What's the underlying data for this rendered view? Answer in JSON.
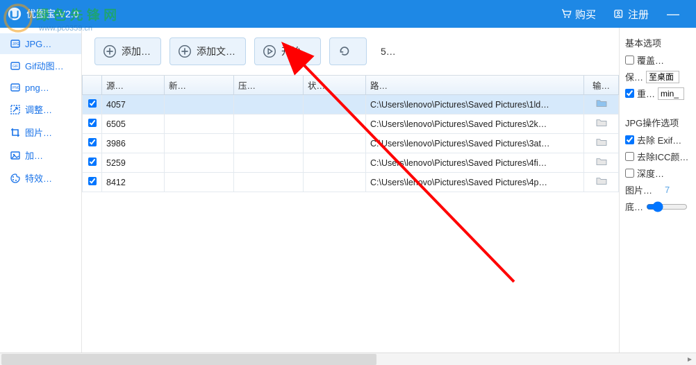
{
  "title": "优图宝-V2.0",
  "watermark_url": "www.pc0359.cn",
  "header": {
    "buy": "购买",
    "register": "注册"
  },
  "sidebar": {
    "items": [
      {
        "label": "JPG…",
        "icon": "jpg"
      },
      {
        "label": "Gif动图…",
        "icon": "gif"
      },
      {
        "label": "png…",
        "icon": "png"
      },
      {
        "label": "调整…",
        "icon": "resize"
      },
      {
        "label": "图片…",
        "icon": "crop"
      },
      {
        "label": "加…",
        "icon": "image"
      },
      {
        "label": "特效…",
        "icon": "palette"
      }
    ]
  },
  "toolbar": {
    "add": "添加…",
    "add_folder": "添加文…",
    "start": "开始…",
    "refresh": "",
    "count": "5…"
  },
  "table": {
    "headers": {
      "source": "源…",
      "new": "新…",
      "compress": "压…",
      "status": "状…",
      "path": "路…",
      "output": "输…"
    },
    "rows": [
      {
        "checked": true,
        "source": "4057",
        "new": "",
        "compress": "",
        "status": "",
        "path": "C:\\Users\\lenovo\\Pictures\\Saved Pictures\\1ld…",
        "selected": true
      },
      {
        "checked": true,
        "source": "6505",
        "new": "",
        "compress": "",
        "status": "",
        "path": "C:\\Users\\lenovo\\Pictures\\Saved Pictures\\2k…",
        "selected": false
      },
      {
        "checked": true,
        "source": "3986",
        "new": "",
        "compress": "",
        "status": "",
        "path": "C:\\Users\\lenovo\\Pictures\\Saved Pictures\\3at…",
        "selected": false
      },
      {
        "checked": true,
        "source": "5259",
        "new": "",
        "compress": "",
        "status": "",
        "path": "C:\\Users\\lenovo\\Pictures\\Saved Pictures\\4fi…",
        "selected": false
      },
      {
        "checked": true,
        "source": "8412",
        "new": "",
        "compress": "",
        "status": "",
        "path": "C:\\Users\\lenovo\\Pictures\\Saved Pictures\\4p…",
        "selected": false
      }
    ]
  },
  "right_panel": {
    "basic_title": "基本选项",
    "overwrite": {
      "checked": false,
      "label": "覆盖…"
    },
    "save": {
      "label": "保…",
      "value": "至桌面"
    },
    "rename": {
      "checked": true,
      "label": "重…",
      "value": "min_"
    },
    "jpg_title": "JPG操作选项",
    "exif": {
      "checked": true,
      "label": "去除 Exif…"
    },
    "icc": {
      "checked": false,
      "label": "去除ICC颜…"
    },
    "depth": {
      "checked": false,
      "label": "深度…"
    },
    "image": {
      "label": "图片…",
      "value": "7"
    },
    "bottom": {
      "label": "底…"
    }
  }
}
